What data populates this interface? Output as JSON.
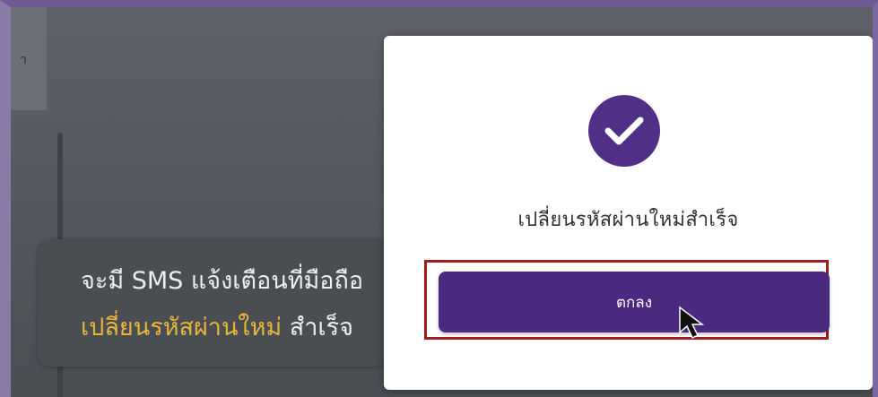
{
  "background": {
    "partial_text": " า"
  },
  "modal": {
    "message": "เปลี่ยนรหัสผ่านใหม่สำเร็จ",
    "ok_button_label": "ตกลง",
    "icon": "check-circle-icon"
  },
  "callout": {
    "line1": "จะมี SMS แจ้งเตือนที่มือถือ",
    "line2_highlight": "เปลี่ยนรหัสผ่านใหม่",
    "line2_rest": "สำเร็จ"
  },
  "colors": {
    "brand_purple": "#4a2a80",
    "highlight_border": "#a11c1c",
    "callout_highlight": "#e8b73a"
  }
}
